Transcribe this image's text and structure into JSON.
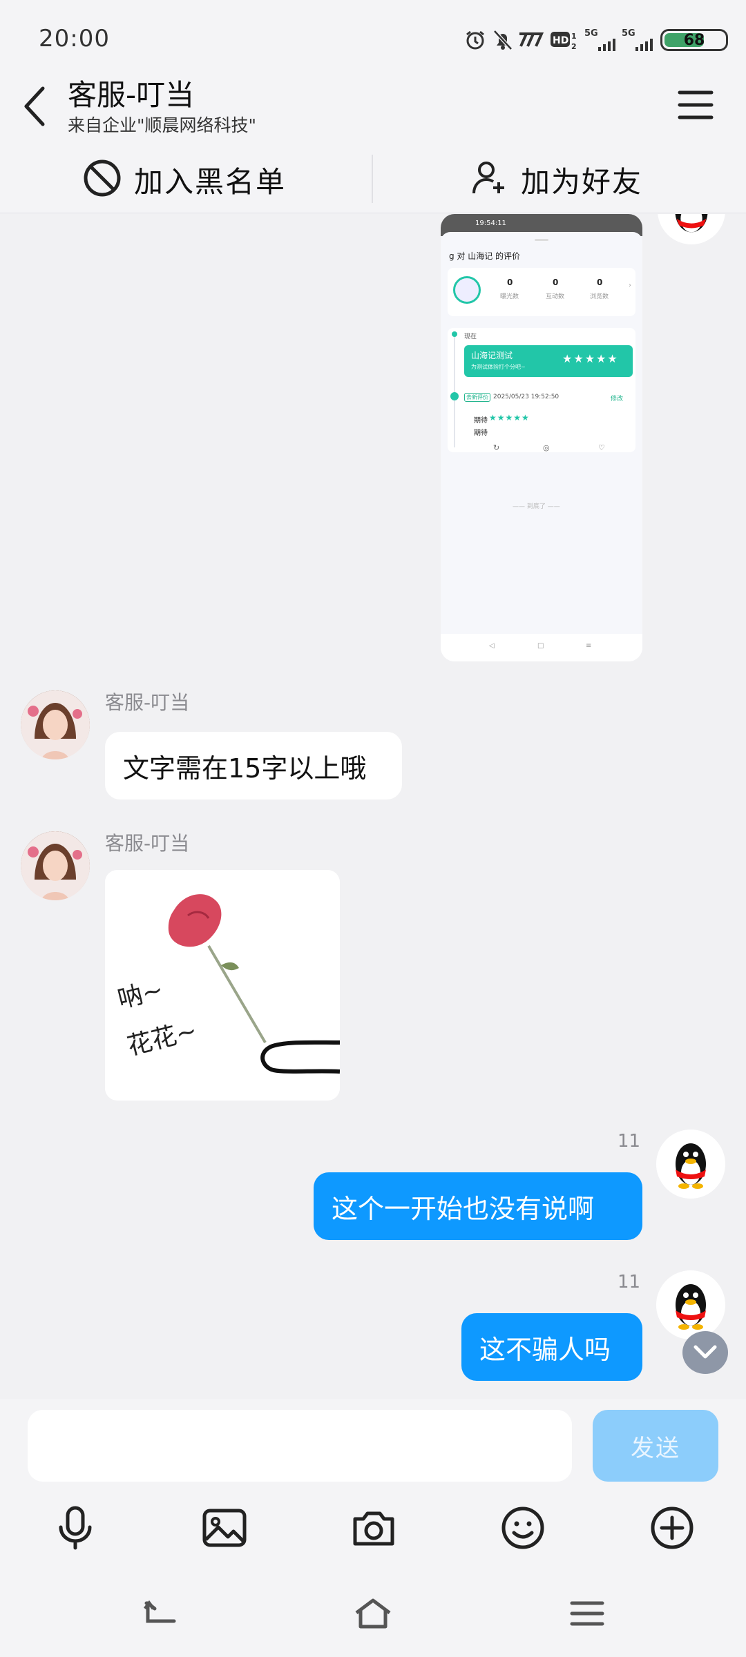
{
  "status_bar": {
    "time": "20:00",
    "battery": "68"
  },
  "header": {
    "title": "客服-叮当",
    "subtitle": "来自企业\"顺晨网络科技\""
  },
  "actions": {
    "blacklist": "加入黑名单",
    "add_friend": "加为好友"
  },
  "screenshot_preview": {
    "status_time": "19:54:11",
    "title": "g 对 山海记 的评价",
    "stats": [
      {
        "value": "0",
        "label": "曝光数"
      },
      {
        "value": "0",
        "label": "互动数"
      },
      {
        "value": "0",
        "label": "浏览数"
      }
    ],
    "now_label": "现在",
    "card_title": "山海记测试",
    "card_subtitle": "为测试体验打个分吧~",
    "tag": "去新评价",
    "date": "2025/05/23 19:52:50",
    "edit": "修改",
    "expect_label": "期待",
    "expect_text": "期待",
    "end_text": "—— 到底了 ——"
  },
  "messages": [
    {
      "sender": "客服-叮当",
      "text": "文字需在15字以上哦"
    },
    {
      "sender": "客服-叮当",
      "sticker_text_1": "呐~",
      "sticker_text_2": "花花~"
    },
    {
      "time": "11",
      "text": "这个一开始也没有说啊"
    },
    {
      "time": "11",
      "text": "这不骗人吗"
    }
  ],
  "input": {
    "placeholder": "",
    "send_label": "发送"
  },
  "colors": {
    "outgoing_bubble": "#0e99ff",
    "send_button": "#8ccdfb",
    "accent_green": "#22c6a8"
  }
}
